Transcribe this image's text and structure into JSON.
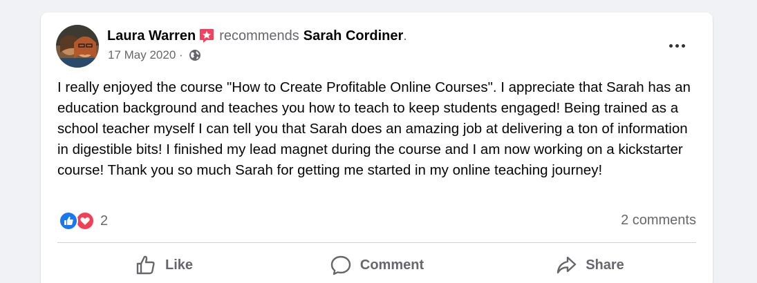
{
  "post": {
    "author_name": "Laura Warren",
    "recommend_verb": "recommends",
    "page_name": "Sarah Cordiner",
    "trailing_punct": ".",
    "date": "17 May 2020",
    "separator": " · ",
    "privacy_icon": "globe-icon",
    "body": "I really enjoyed the course \"How to Create Profitable Online Courses\". I appreciate that Sarah has an education background and teaches you how to teach to keep students engaged! Being trained as a school teacher myself I can tell you that Sarah does an amazing job at delivering a ton of information in digestible bits! I finished my lead magnet during the course and I am now working on a kickstarter course! Thank you so much Sarah for getting me started in my online teaching journey!"
  },
  "reactions": {
    "count": "2",
    "types": [
      "like-icon",
      "love-icon"
    ]
  },
  "comments_count": "2 comments",
  "actions": {
    "like_label": "Like",
    "comment_label": "Comment",
    "share_label": "Share"
  },
  "colors": {
    "like_blue": "#1877f2",
    "love_red": "#f33e58",
    "recommend_badge": "#f3425f",
    "secondary_text": "#65676b"
  }
}
